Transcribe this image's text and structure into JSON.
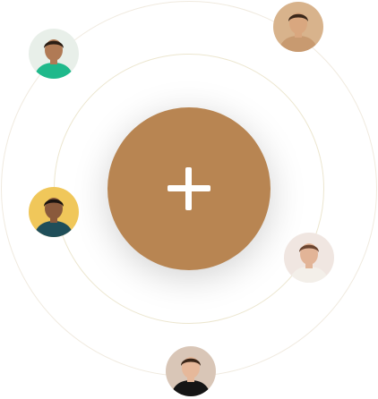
{
  "center_action": {
    "icon": "plus-icon",
    "color": "#b88552"
  },
  "avatars": [
    {
      "name": "avatar-man-green-shirt",
      "bg": "#e8efe9",
      "skin": "#b07a55",
      "hair": "#2a1d14",
      "shirt": "#1fb98b"
    },
    {
      "name": "avatar-man-light-skin",
      "bg": "#d8b38c",
      "skin": "#d9a77f",
      "hair": "#3a2719",
      "shirt": "#c89a70"
    },
    {
      "name": "avatar-man-beard",
      "bg": "#f0c75a",
      "skin": "#8a5a3c",
      "hair": "#1b1410",
      "shirt": "#1f4e59"
    },
    {
      "name": "avatar-woman-smiling",
      "bg": "#f0e6e1",
      "skin": "#e2b497",
      "hair": "#6b4530",
      "shirt": "#f3efe9"
    },
    {
      "name": "avatar-man-hoodie",
      "bg": "#d9c6b7",
      "skin": "#e6b89a",
      "hair": "#3b2618",
      "shirt": "#151515"
    }
  ]
}
